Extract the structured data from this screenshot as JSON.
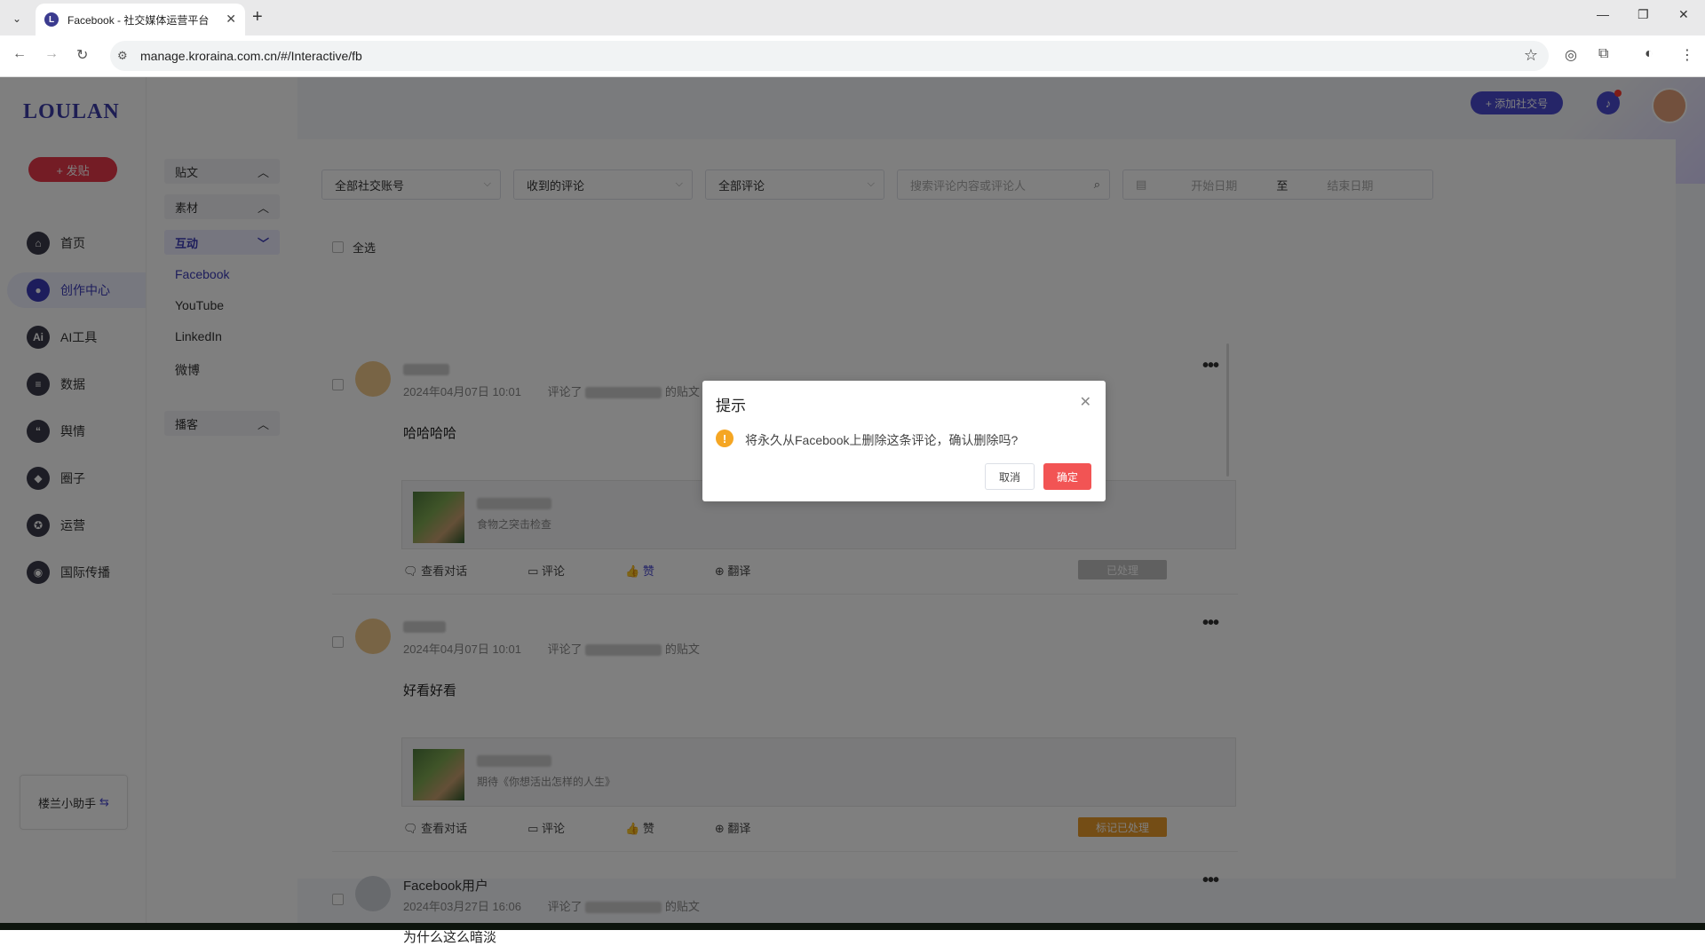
{
  "browser": {
    "tab_title": "Facebook - 社交媒体运营平台",
    "url": "manage.kroraina.com.cn/#/Interactive/fb"
  },
  "sidebar": {
    "logo": "LOULAN",
    "post_button": "+ 发贴",
    "items": [
      {
        "label": "首页",
        "icon": "home-icon"
      },
      {
        "label": "创作中心",
        "icon": "palette-icon"
      },
      {
        "label": "AI工具",
        "icon": "ai-icon"
      },
      {
        "label": "数据",
        "icon": "database-icon"
      },
      {
        "label": "舆情",
        "icon": "quote-icon"
      },
      {
        "label": "圈子",
        "icon": "compass-icon"
      },
      {
        "label": "运营",
        "icon": "badge-icon"
      },
      {
        "label": "国际传播",
        "icon": "globe-icon"
      }
    ],
    "helper": "楼兰小助手"
  },
  "subnav": {
    "group_posts": "贴文",
    "group_materials": "素材",
    "group_interact": "互动",
    "links": [
      "Facebook",
      "YouTube",
      "LinkedIn",
      "微博"
    ],
    "group_podcast": "播客"
  },
  "topbar": {
    "add_account": "+ 添加社交号"
  },
  "filters": {
    "account": "全部社交账号",
    "type": "收到的评论",
    "scope": "全部评论",
    "search_placeholder": "搜索评论内容或评论人",
    "start_date": "开始日期",
    "to": "至",
    "end_date": "结束日期"
  },
  "select_all": "全选",
  "comments": [
    {
      "time": "2024年04月07日 10:01",
      "commented": "评论了",
      "post_suffix": "的贴文",
      "text": "哈哈哈哈",
      "post_desc": "食物之突击检查",
      "actions": [
        "查看对话",
        "评论",
        "赞",
        "翻译"
      ],
      "status": "已处理"
    },
    {
      "time": "2024年04月07日 10:01",
      "commented": "评论了",
      "post_suffix": "的贴文",
      "text": "好看好看",
      "post_desc": "期待《你想活出怎样的人生》",
      "actions": [
        "查看对话",
        "评论",
        "赞",
        "翻译"
      ],
      "status": "标记已处理"
    },
    {
      "name": "Facebook用户",
      "time": "2024年03月27日 16:06",
      "commented": "评论了",
      "post_suffix": "的贴文",
      "text": "为什么这么暗淡"
    }
  ],
  "dialog": {
    "title": "提示",
    "message": "将永久从Facebook上删除这条评论，确认删除吗?",
    "cancel": "取消",
    "confirm": "确定"
  }
}
